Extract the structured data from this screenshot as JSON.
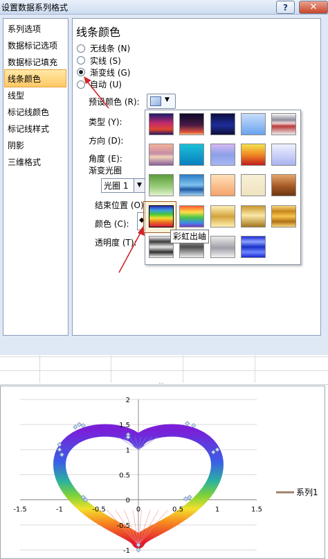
{
  "window": {
    "title": "设置数据系列格式",
    "help_label": "?",
    "close_label": "✕"
  },
  "sidebar": {
    "items": [
      {
        "label": "系列选项"
      },
      {
        "label": "数据标记选项"
      },
      {
        "label": "数据标记填充"
      },
      {
        "label": "线条颜色",
        "selected": true
      },
      {
        "label": "线型"
      },
      {
        "label": "标记线颜色"
      },
      {
        "label": "标记线样式"
      },
      {
        "label": "阴影"
      },
      {
        "label": "三维格式"
      }
    ]
  },
  "line_color": {
    "title": "线条颜色",
    "options": [
      {
        "label": "无线条 (N)",
        "checked": false
      },
      {
        "label": "实线 (S)",
        "checked": false
      },
      {
        "label": "渐变线 (G)",
        "checked": true
      },
      {
        "label": "自动 (U)",
        "checked": false
      }
    ],
    "preset_label": "预设颜色 (R):",
    "type_label": "类型 (Y):",
    "direction_label": "方向 (D):",
    "angle_label": "角度 (E):",
    "gradient_stops_label": "渐变光圈",
    "stop_select_value": "光圈 1",
    "end_position_label": "结束位置 (O):",
    "color_label": "颜色 (C):",
    "transparency_label": "透明度 (T):"
  },
  "gallery": {
    "tooltip": "彩虹出岫",
    "selected_index": 15,
    "presets": [
      "linear-gradient(#1c1a6e,#c22a6d 45%,#e0462f 75%,#2a1660)",
      "linear-gradient(#0a0a28,#4a1a45 55%,#e3563c 90%,#f8c27a)",
      "linear-gradient(#0b0d3e,#1d2d9a 55%,#0e0e3a)",
      "linear-gradient(#c7ddf9,#6aa3ef)",
      "linear-gradient(#f6f6f6,#8c8c9a 30%,#f4d2d2 45%,#b83a3a 60%,#ececec)",
      "linear-gradient(#f6b29a,#c58ca7 45%,#f2d4b8 60%,#8a5d9a)",
      "linear-gradient(#1bc0d8,#0a7fbf)",
      "linear-gradient(#d6b8f4,#8da0e8 50%,#a6b7f2)",
      "linear-gradient(#f5e24e,#f08a23 50%,#c01c1c)",
      "linear-gradient(#eef1ff,#a9b4f0)",
      "linear-gradient(#5c9c3a,#9dcf7e 60%,#e3f2d0)",
      "linear-gradient(#2a7cc6,#7fc2ee 50%,#1f5aa6 70%,#9fd3f5)",
      "linear-gradient(#ffe0b8,#f4a36a)",
      "linear-gradient(#f7f0d6,#efe2bf)",
      "linear-gradient(#e4a66a,#a55a25 55%,#6d3513)",
      "linear-gradient(#2d2db5,#3b9de3 20%,#46c53a 40%,#f3e232 58%,#ef7422 76%,#d31c3b)",
      "linear-gradient(#ff5a2f,#ffe048 30%,#47c44c 55%,#3b8de3 80%,#7a39c9)",
      "linear-gradient(#fff2b5,#d2a33e 50%,#fff0b0)",
      "linear-gradient(#c6972f,#fbe9a6 45%,#a4771d)",
      "linear-gradient(#f9d87a,#c6861c 25%,#f7c44e 50%,#b07014 75%,#f9d87a)",
      "linear-gradient(#f5f5f5,#3a3a3a 25%,#e9e9e9 50%,#2f2f2f 75%,#f5f5f5)",
      "linear-gradient(#d9d9d9,#4d4d4d 50%,#ededed)",
      "linear-gradient(#ececec,#9fa0a8 55%,#f3f3f3)",
      "linear-gradient(#1a2bd6,#8fa2ff 25%,#1530c7 50%,#6f86ff 75%,#1a2bd6)"
    ]
  },
  "chart_data": {
    "type": "scatter",
    "title": "",
    "xlabel": "",
    "ylabel": "",
    "xlim": [
      -1.5,
      1.5
    ],
    "ylim": [
      -1,
      2
    ],
    "x_ticks": [
      -1.5,
      -1,
      -0.5,
      0,
      0.5,
      1,
      1.5
    ],
    "y_ticks": [
      -1,
      -0.5,
      0,
      0.5,
      1,
      1.5,
      2
    ],
    "x_tick_labels": [
      "-1.5",
      "-1",
      "-0.5",
      "0",
      "0.5",
      "1",
      "1.5"
    ],
    "y_tick_labels": [
      "-1",
      "-0.5",
      "0",
      "0.5",
      "1",
      "1.5",
      "2"
    ],
    "grid": true,
    "legend": "right",
    "series": [
      {
        "name": "系列1",
        "line_style": "rainbow-gradient",
        "marker": "diamond",
        "markers": [
          [
            -0.8,
            1.45
          ],
          [
            -0.75,
            1.5
          ],
          [
            -0.7,
            1.48
          ],
          [
            -1.0,
            1.1
          ],
          [
            -1.0,
            1.0
          ],
          [
            -0.97,
            0.9
          ],
          [
            -0.7,
            0.05
          ],
          [
            -0.67,
            0.0
          ],
          [
            0.6,
            0.02
          ],
          [
            0.65,
            0.05
          ],
          [
            0.95,
            0.95
          ],
          [
            1.0,
            1.0
          ],
          [
            0.62,
            1.52
          ],
          [
            0.7,
            1.48
          ],
          [
            -0.13,
            1.3
          ],
          [
            -0.13,
            1.25
          ],
          [
            0.0,
            -0.9
          ],
          [
            0.0,
            -1.0
          ]
        ]
      }
    ],
    "legend_swatch_color": "#a0826b"
  }
}
